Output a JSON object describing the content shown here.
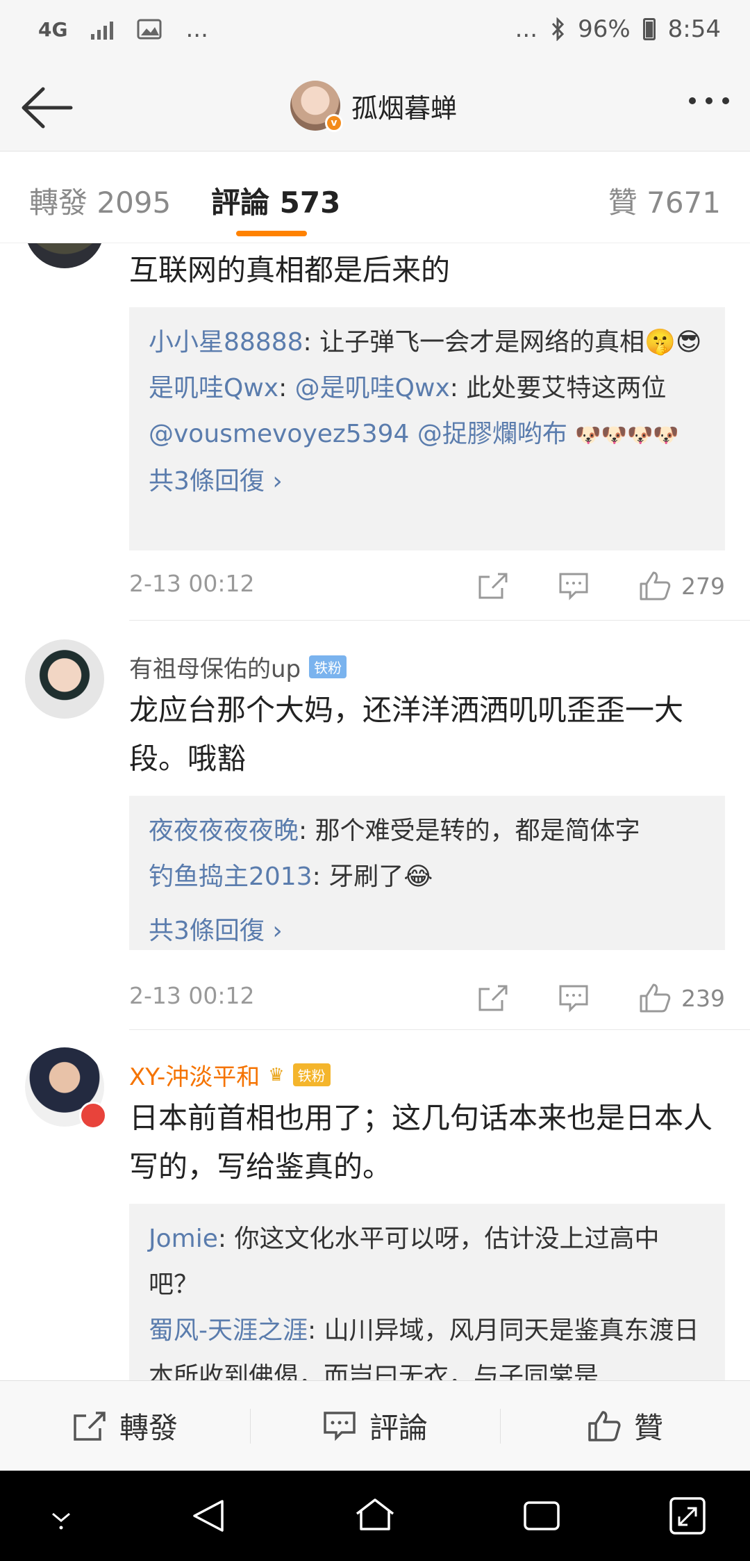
{
  "status": {
    "network": "4G",
    "left_more": "...",
    "right_more": "...",
    "battery": "96%",
    "time": "8:54"
  },
  "header": {
    "name": "孤烟暮蝉",
    "avatar_badge": "v"
  },
  "tabs": [
    {
      "label": "轉發 2095"
    },
    {
      "label": "評論 573"
    },
    {
      "label": "贊 7671"
    }
  ],
  "comments": [
    {
      "text": "互联网的真相都是后来的",
      "replies": [
        {
          "user": "小小星88888",
          "text": ": 让子弹飞一会才是网络的真相🤫😎"
        },
        {
          "user": "是叽哇Qwx",
          "text": ": ",
          "mention": "@是叽哇Qwx",
          "text2": ": 此处要艾特这两位"
        },
        {
          "mentions": "@vousmevoyez5394 @捉膠爛哟布",
          "emoji": "🐶🐶🐶🐶"
        }
      ],
      "more": "共3條回復 ›",
      "time": "2-13 00:12",
      "likes": "279"
    },
    {
      "user": "有祖母保佑的up",
      "badge": "铁粉",
      "text": "龙应台那个大妈，还洋洋洒洒叽叽歪歪一大段。哦豁",
      "replies": [
        {
          "user": "夜夜夜夜夜晚",
          "text": ": 那个难受是转的，都是简体字"
        },
        {
          "user": "钓鱼捣主2013",
          "text": ": 牙刷了😂"
        }
      ],
      "more": "共3條回復 ›",
      "time": "2-13 00:12",
      "likes": "239"
    },
    {
      "user": "XY-沖淡平和",
      "badge": "铁粉",
      "text": "日本前首相也用了；这几句话本来也是日本人写的，写给鉴真的。",
      "replies": [
        {
          "user": "Jomie",
          "text": ": 你这文化水平可以呀，估计没上过高中吧？"
        },
        {
          "user": "蜀风-天涯之涯",
          "text": ": 山川异域，风月同天是鉴真东渡日本所收到佛偈，而岂曰无衣，与子同裳是"
        }
      ]
    }
  ],
  "actions": {
    "repost": "轉發",
    "comment": "評論",
    "like": "贊"
  }
}
